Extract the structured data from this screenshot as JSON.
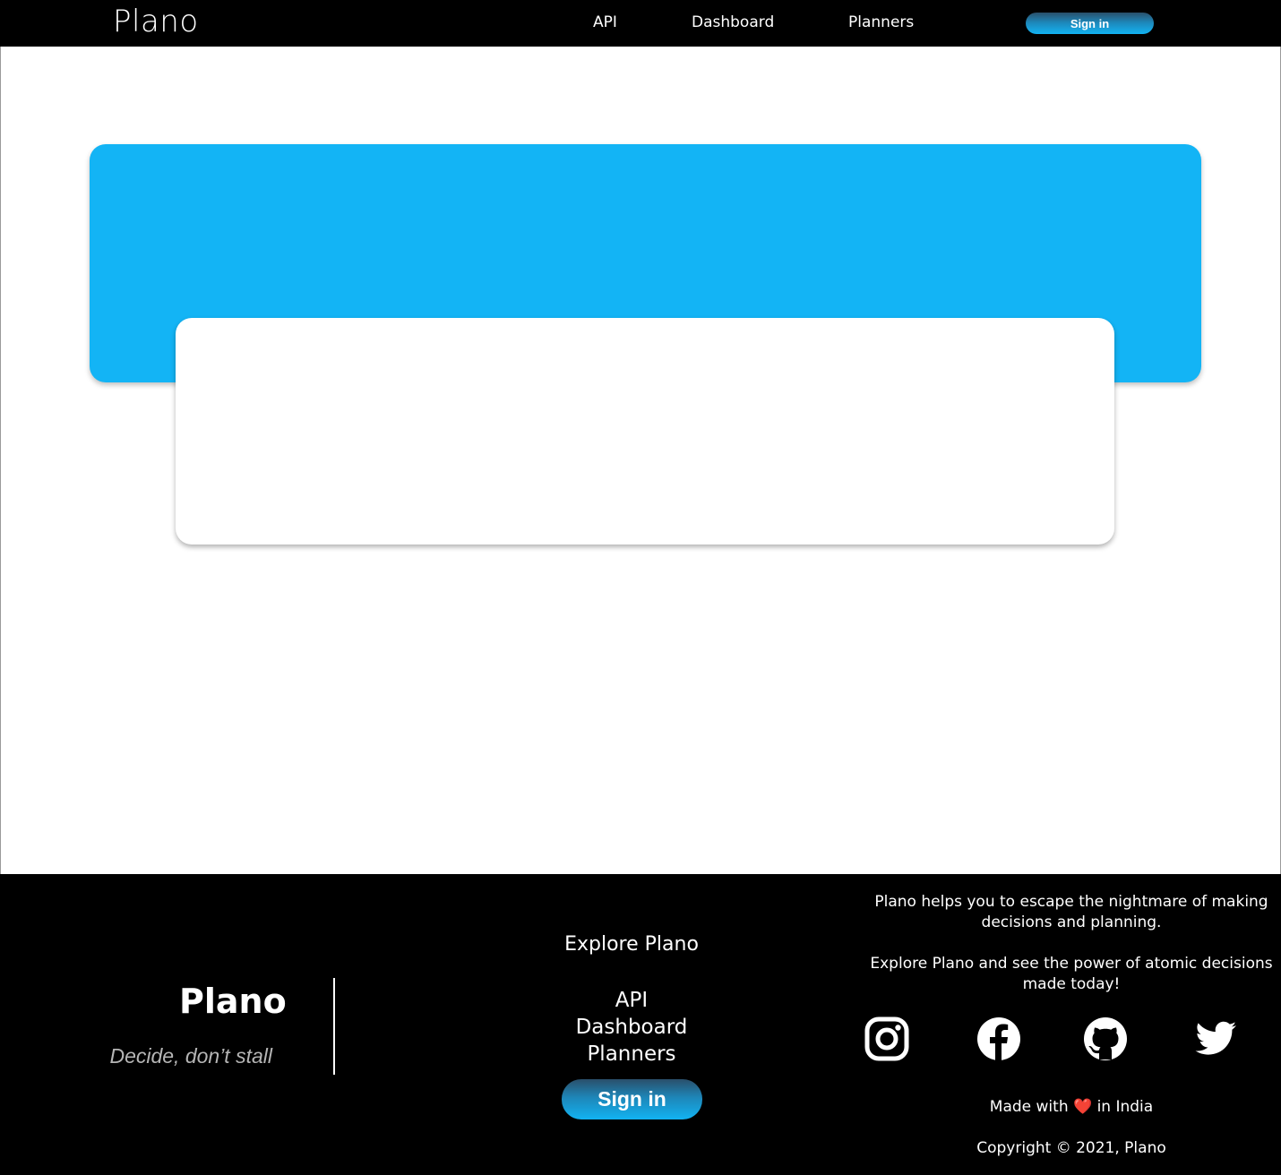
{
  "nav": {
    "brand": "Plano",
    "links": [
      "API",
      "Dashboard",
      "Planners"
    ],
    "signin_label": "Sign in"
  },
  "colors": {
    "banner": "#13b4f5",
    "background": "#ffffff",
    "nav_bg": "#000000",
    "heart": "#ff3b3b"
  },
  "footer": {
    "brand": "Plano",
    "tagline": "Decide, don’t stall",
    "explore_title": "Explore Plano",
    "links": [
      "API",
      "Dashboard",
      "Planners"
    ],
    "signin_label": "Sign in",
    "about_1": "Plano helps you to escape the nightmare of making decisions and planning.",
    "about_2": "Explore Plano and see the power of atomic decisions made today!",
    "social_icons": [
      "instagram-icon",
      "facebook-icon",
      "github-icon",
      "twitter-icon"
    ],
    "made_prefix": "Made with",
    "heart": "❤️",
    "made_suffix": "in India",
    "copyright": "Copyright © 2021, Plano"
  }
}
